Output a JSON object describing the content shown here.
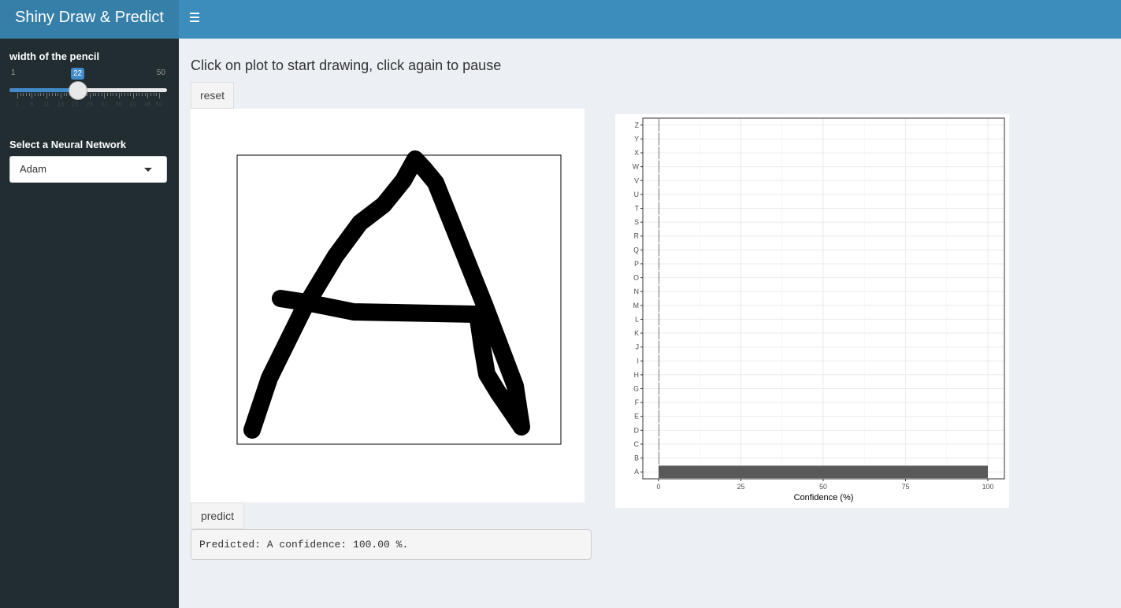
{
  "header": {
    "title": "Shiny Draw & Predict",
    "menu_icon": "hamburger-icon"
  },
  "sidebar": {
    "slider": {
      "label": "width of the pencil",
      "min": "1",
      "max": "50",
      "value": "22",
      "ticks": [
        "1",
        "6",
        "11",
        "16",
        "21",
        "26",
        "31",
        "36",
        "41",
        "46",
        "50"
      ]
    },
    "network": {
      "label": "Select a Neural Network",
      "selected": "Adam"
    }
  },
  "main": {
    "instructions": "Click on plot to start drawing, click again to pause",
    "reset_label": "reset",
    "predict_label": "predict",
    "prediction_text": "Predicted: A confidence: 100.00 %."
  },
  "chart_data": {
    "type": "bar",
    "orientation": "horizontal",
    "categories": [
      "A",
      "B",
      "C",
      "D",
      "E",
      "F",
      "G",
      "H",
      "I",
      "J",
      "K",
      "L",
      "M",
      "N",
      "O",
      "P",
      "Q",
      "R",
      "S",
      "T",
      "U",
      "V",
      "W",
      "X",
      "Y",
      "Z"
    ],
    "values": [
      100,
      0,
      0,
      0,
      0,
      0,
      0,
      0,
      0,
      0,
      0,
      0,
      0,
      0,
      0,
      0,
      0,
      0,
      0,
      0,
      0,
      0,
      0,
      0,
      0,
      0
    ],
    "xlabel": "Confidence (%)",
    "ylabel": "",
    "xlim": [
      0,
      100
    ],
    "xticks": [
      "0",
      "25",
      "50",
      "75",
      "100"
    ],
    "grid": true,
    "bar_color": "#595959"
  },
  "colors": {
    "navbar": "#3c8dbc",
    "logo": "#367fa9",
    "sidebar": "#222d32",
    "content_bg": "#ecf0f5",
    "slider": "#428bca"
  }
}
